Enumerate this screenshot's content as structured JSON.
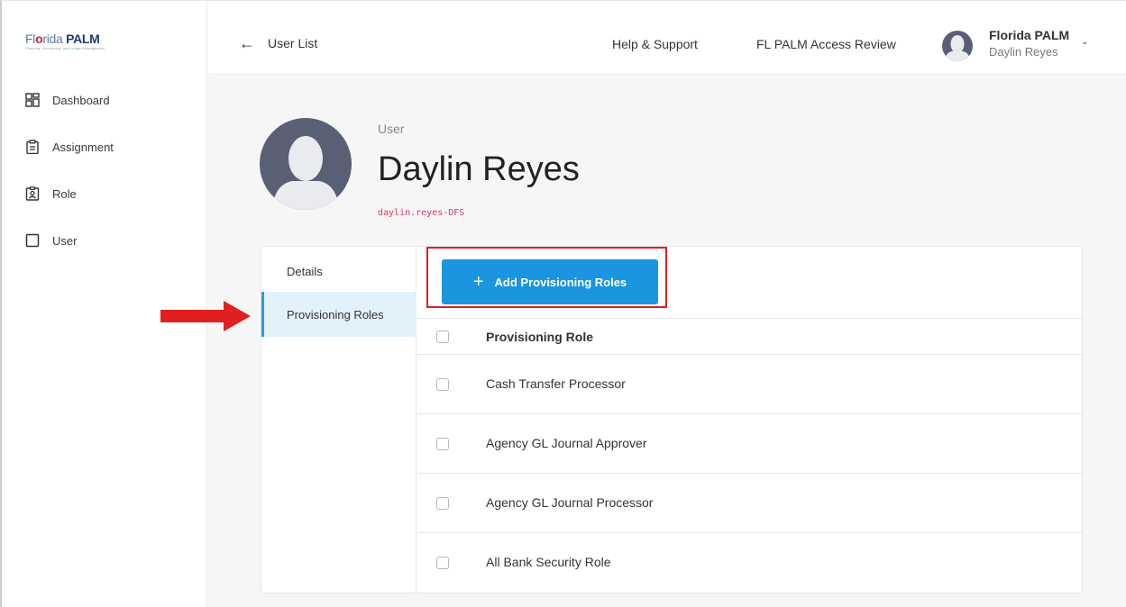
{
  "brand": {
    "logo_prefix": "Fl",
    "logo_o": "o",
    "logo_rest": "rida ",
    "logo_bold": "PALM",
    "logo_tagline": "Planning, Accounting, and Ledger Management",
    "accent_color": "#1b95e0"
  },
  "sidebar": {
    "items": [
      {
        "label": "Dashboard",
        "icon": "dashboard-icon"
      },
      {
        "label": "Assignment",
        "icon": "clipboard-icon"
      },
      {
        "label": "Role",
        "icon": "badge-icon"
      },
      {
        "label": "User",
        "icon": "user-square-icon"
      }
    ]
  },
  "topbar": {
    "back_label": "User List",
    "help_link": "Help & Support",
    "review_link": "FL PALM Access Review",
    "account_org": "Florida PALM",
    "account_name": "Daylin Reyes"
  },
  "profile": {
    "label": "User",
    "name": "Daylin Reyes",
    "handle": "daylin.reyes-DFS"
  },
  "tabs": [
    {
      "label": "Details",
      "active": false
    },
    {
      "label": "Provisioning Roles",
      "active": true
    }
  ],
  "toolbar": {
    "add_label": "Add Provisioning Roles"
  },
  "table": {
    "header": "Provisioning Role",
    "rows": [
      "Cash Transfer Processor",
      "Agency GL Journal Approver",
      "Agency GL Journal Processor",
      "All Bank Security Role"
    ]
  }
}
